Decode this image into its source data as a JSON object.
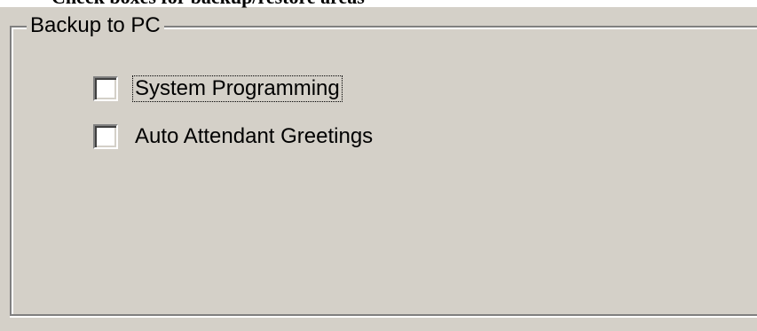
{
  "header_fragment": "Check boxes for backup/restore areas",
  "group": {
    "legend": "Backup to PC",
    "options": [
      {
        "label": "System Programming",
        "checked": false,
        "focused": true
      },
      {
        "label": "Auto Attendant Greetings",
        "checked": false,
        "focused": false
      }
    ]
  },
  "colors": {
    "face": "#d4d0c8",
    "shadow": "#808080",
    "highlight": "#ffffff"
  }
}
